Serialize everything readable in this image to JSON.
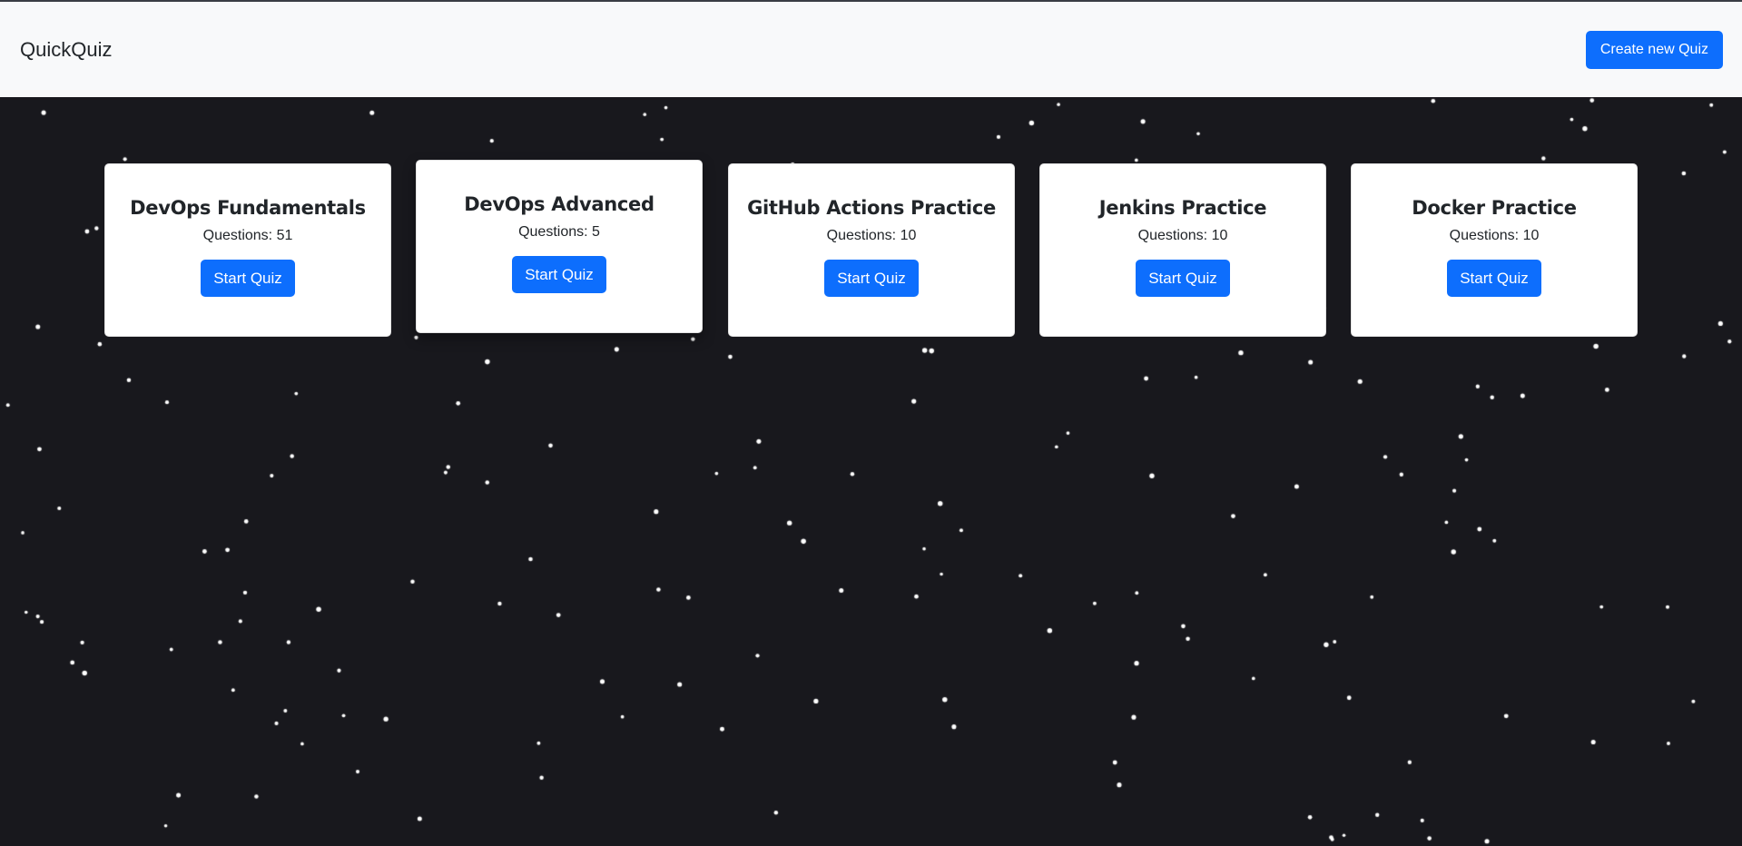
{
  "navbar": {
    "brand": "QuickQuiz",
    "create_label": "Create new Quiz"
  },
  "count_prefix": "Questions: ",
  "quizzes": [
    {
      "title": "DevOps Fundamentals",
      "questions": "51",
      "start_label": "Start Quiz"
    },
    {
      "title": "DevOps Advanced",
      "questions": "5",
      "start_label": "Start Quiz"
    },
    {
      "title": "GitHub Actions Practice",
      "questions": "10",
      "start_label": "Start Quiz"
    },
    {
      "title": "Jenkins Practice",
      "questions": "10",
      "start_label": "Start Quiz"
    },
    {
      "title": "Docker Practice",
      "questions": "10",
      "start_label": "Start Quiz"
    }
  ],
  "colors": {
    "background": "#18181d",
    "navbar": "#f8f9fa",
    "primary": "#0d6efd",
    "star": "#ffffff"
  }
}
